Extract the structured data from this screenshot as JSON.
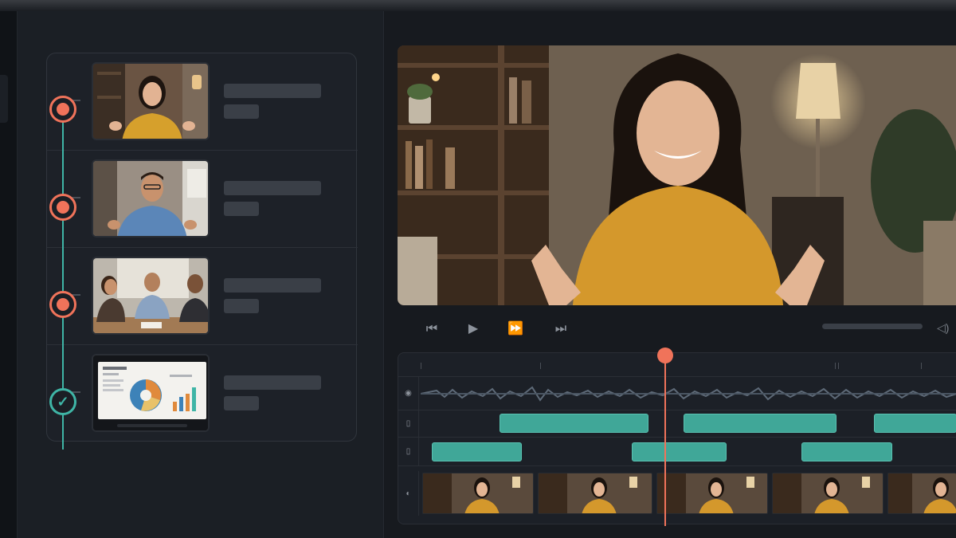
{
  "colors": {
    "accent_coral": "#f0735a",
    "accent_teal": "#3fb5a6",
    "clip_teal": "#44b3a2",
    "panel_dark": "#1b1f25",
    "placeholder_bar": "#3a3f47"
  },
  "steps": [
    {
      "status": "pending",
      "status_icon": "record-dot-icon",
      "thumbnail": "woman-talking-to-camera"
    },
    {
      "status": "pending",
      "status_icon": "record-dot-icon",
      "thumbnail": "man-presenting"
    },
    {
      "status": "pending",
      "status_icon": "record-dot-icon",
      "thumbnail": "team-meeting"
    },
    {
      "status": "done",
      "status_icon": "check-icon",
      "thumbnail": "laptop-with-charts"
    }
  ],
  "transport": {
    "icons": [
      "skip-back-icon",
      "play-icon",
      "fast-forward-icon",
      "skip-forward-icon",
      "volume-icon"
    ]
  },
  "timeline": {
    "track_icons": [
      "audio-track-icon",
      "caption-track-icon",
      "caption-track-icon",
      "video-track-icon"
    ],
    "playhead_icon": "playhead-icon"
  }
}
